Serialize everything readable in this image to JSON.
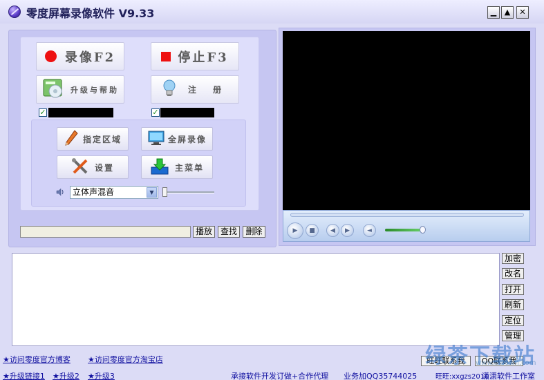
{
  "window": {
    "title": "零度屏幕录像软件 V9.33",
    "minimize_label": "▁",
    "maximize_label": "▲",
    "close_label": "✕"
  },
  "controls": {
    "record_label": "录像F2",
    "stop_label": "停止F3",
    "upgrade_help_label": "升级与帮助",
    "register_label": "注  册",
    "checkbox_left_checked": true,
    "checkbox_right_checked": true,
    "check_mark": "✓"
  },
  "tools": {
    "select_region_label": "指定区域",
    "fullscreen_label": "全屏录像",
    "settings_label": "设置",
    "main_menu_label": "主菜单"
  },
  "audio": {
    "source_selected": "立体声混音",
    "dropdown_arrow": "▼"
  },
  "file_actions": {
    "play_label": "播放",
    "find_label": "查找",
    "delete_label": "删除"
  },
  "side_buttons": [
    "加密",
    "改名",
    "打开",
    "刷新",
    "定位",
    "管理"
  ],
  "footer": {
    "link_blog": "★访问零度官方博客",
    "link_taobao": "★访问零度官方淘宝店",
    "link_upgrade1": "★升级链接1",
    "link_upgrade2": "★升级2",
    "link_upgrade3": "★升级3",
    "agency_text": "承接软件开发订做+合作代理",
    "business_qq": "业务加QQ35744025",
    "wangwang": "旺旺:xxgzs2010",
    "studio": "潇潇软件工作室",
    "wangwang_btn": "旺旺联系我",
    "qq_btn": "QQ联系我"
  },
  "watermark": {
    "text": "绿茶下载站",
    "url": "www.lhdown.com"
  },
  "colors": {
    "record_dot": "#ee1111",
    "stop_square": "#ee1111",
    "background": "#dcdcf6"
  }
}
